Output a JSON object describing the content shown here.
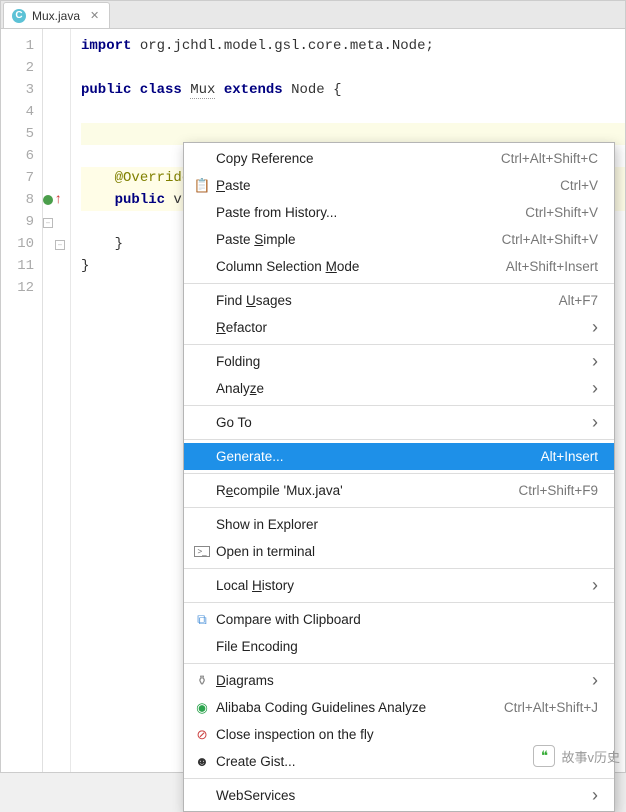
{
  "tab": {
    "filename": "Mux.java",
    "icon_letter": "C"
  },
  "code": {
    "lines": [
      {
        "n": 1,
        "html": "<span class='kw'>import</span> org.jchdl.model.gsl.core.meta.Node;"
      },
      {
        "n": 2,
        "html": ""
      },
      {
        "n": 3,
        "html": "<span class='kw'>public class</span> <span class='underline-dashed'>Mux</span> <span class='kw'>extends</span> Node {"
      },
      {
        "n": 4,
        "html": ""
      },
      {
        "n": 5,
        "html": "",
        "caret": true
      },
      {
        "n": 6,
        "html": ""
      },
      {
        "n": 7,
        "html": "    <span class='anno'>@Override</span>",
        "highlight": true
      },
      {
        "n": 8,
        "html": "    <span class='kw'>public</span> v",
        "highlight": true,
        "marker": "override",
        "fold": "open"
      },
      {
        "n": 9,
        "html": ""
      },
      {
        "n": 10,
        "html": "    }",
        "fold": "close"
      },
      {
        "n": 11,
        "html": "}"
      },
      {
        "n": 12,
        "html": ""
      }
    ]
  },
  "menu": {
    "groups": [
      [
        {
          "label": "Copy Reference",
          "shortcut": "Ctrl+Alt+Shift+C"
        },
        {
          "label": "Paste",
          "u": 0,
          "shortcut": "Ctrl+V",
          "icon": "paste"
        },
        {
          "label": "Paste from History...",
          "shortcut": "Ctrl+Shift+V"
        },
        {
          "label": "Paste Simple",
          "u": 6,
          "shortcut": "Ctrl+Alt+Shift+V"
        },
        {
          "label": "Column Selection Mode",
          "u": 17,
          "shortcut": "Alt+Shift+Insert"
        }
      ],
      [
        {
          "label": "Find Usages",
          "u": 5,
          "shortcut": "Alt+F7"
        },
        {
          "label": "Refactor",
          "u": 0,
          "submenu": true
        }
      ],
      [
        {
          "label": "Folding",
          "submenu": true
        },
        {
          "label": "Analyze",
          "u": 5,
          "submenu": true
        }
      ],
      [
        {
          "label": "Go To",
          "submenu": true
        }
      ],
      [
        {
          "label": "Generate...",
          "shortcut": "Alt+Insert",
          "selected": true
        }
      ],
      [
        {
          "label": "Recompile 'Mux.java'",
          "u": 1,
          "shortcut": "Ctrl+Shift+F9"
        }
      ],
      [
        {
          "label": "Show in Explorer"
        },
        {
          "label": "Open in terminal",
          "icon": "terminal"
        }
      ],
      [
        {
          "label": "Local History",
          "u": 6,
          "submenu": true
        }
      ],
      [
        {
          "label": "Compare with Clipboard",
          "icon": "compare"
        },
        {
          "label": "File Encoding"
        }
      ],
      [
        {
          "label": "Diagrams",
          "u": 0,
          "submenu": true,
          "icon": "diagram"
        },
        {
          "label": "Alibaba Coding Guidelines Analyze",
          "shortcut": "Ctrl+Alt+Shift+J",
          "icon": "alibaba"
        },
        {
          "label": "Close inspection on the fly",
          "icon": "forbid"
        },
        {
          "label": "Create Gist...",
          "icon": "gist"
        }
      ],
      [
        {
          "label": "WebServices",
          "submenu": true
        }
      ]
    ]
  },
  "watermark": {
    "text": "故事v历史"
  }
}
